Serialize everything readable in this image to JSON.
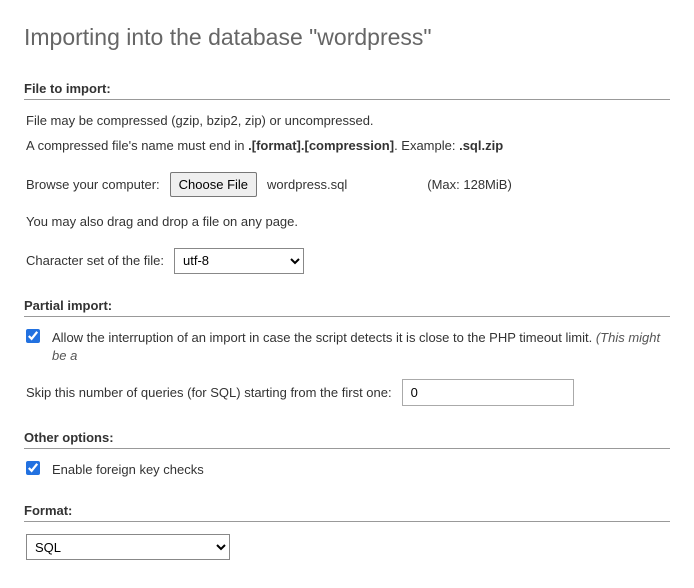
{
  "page_title": "Importing into the database \"wordpress\"",
  "file_import": {
    "header": "File to import:",
    "compress_note": "File may be compressed (gzip, bzip2, zip) or uncompressed.",
    "name_note_prefix": "A compressed file's name must end in ",
    "name_note_bold": ".[format].[compression]",
    "name_note_mid": ". Example: ",
    "name_note_example": ".sql.zip",
    "browse_label": "Browse your computer:",
    "choose_file_btn": "Choose File",
    "selected_file": "wordpress.sql",
    "max_size": "(Max: 128MiB)",
    "dragdrop_note": "You may also drag and drop a file on any page.",
    "charset_label": "Character set of the file:",
    "charset_value": "utf-8"
  },
  "partial_import": {
    "header": "Partial import:",
    "allow_interrupt_checked": true,
    "allow_interrupt_label": "Allow the interruption of an import in case the script detects it is close to the PHP timeout limit. ",
    "allow_interrupt_note": "(This might be a",
    "skip_label": "Skip this number of queries (for SQL) starting from the first one:",
    "skip_value": "0"
  },
  "other_options": {
    "header": "Other options:",
    "fk_checked": true,
    "fk_label": "Enable foreign key checks"
  },
  "format": {
    "header": "Format:",
    "value": "SQL"
  }
}
